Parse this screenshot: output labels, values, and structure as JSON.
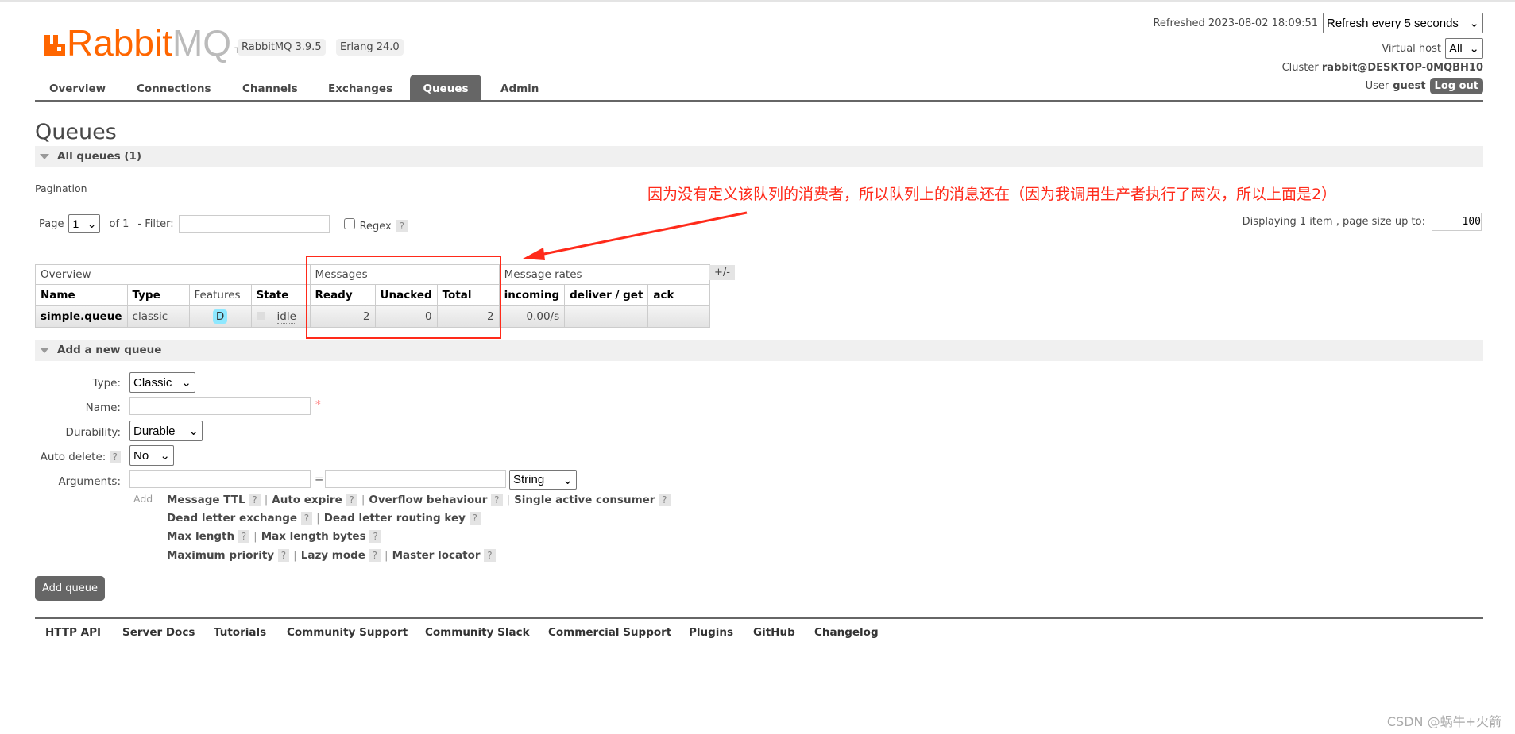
{
  "header": {
    "logo_text_orange": "Rabbit",
    "logo_text_grey": "MQ",
    "logo_tm": "TM",
    "version_rabbitmq": "RabbitMQ 3.9.5",
    "version_erlang": "Erlang 24.0",
    "refreshed": "Refreshed 2023-08-02 18:09:51",
    "refresh_select": "Refresh every 5 seconds",
    "vhost_label": "Virtual host",
    "vhost_select": "All",
    "cluster_label": "Cluster",
    "cluster_name": "rabbit@DESKTOP-0MQBH10",
    "user_label": "User",
    "user_name": "guest",
    "logout": "Log out",
    "brand_color": "#ff6600"
  },
  "tabs": [
    "Overview",
    "Connections",
    "Channels",
    "Exchanges",
    "Queues",
    "Admin"
  ],
  "active_tab": "Queues",
  "page_title": "Queues",
  "all_queues": "All queues (1)",
  "pagination": {
    "label": "Pagination",
    "page_label": "Page",
    "page_value": "1",
    "of": "of 1",
    "filter_label": "- Filter:",
    "filter_value": "",
    "regex_label": "Regex",
    "help": "?",
    "displaying": "Displaying 1 item , page size up to:",
    "page_size": "100"
  },
  "table": {
    "groups": [
      "Overview",
      "Messages",
      "Message rates"
    ],
    "toggle": "+/-",
    "columns": [
      "Name",
      "Type",
      "Features",
      "State",
      "Ready",
      "Unacked",
      "Total",
      "incoming",
      "deliver / get",
      "ack"
    ],
    "rows": [
      {
        "name": "simple.queue",
        "type": "classic",
        "features": "D",
        "state": "idle",
        "ready": "2",
        "unacked": "0",
        "total": "2",
        "incoming": "0.00/s",
        "deliver_get": "",
        "ack": ""
      }
    ]
  },
  "annotation": {
    "text": "因为没有定义该队列的消费者，所以队列上的消息还在（因为我调用生产者执行了两次，所以上面是2）",
    "color": "#ff2a1a"
  },
  "add_queue": {
    "section": "Add a new queue",
    "type_label": "Type:",
    "type_value": "Classic",
    "name_label": "Name:",
    "name_value": "",
    "required": "*",
    "durability_label": "Durability:",
    "durability_value": "Durable",
    "auto_delete_label": "Auto delete:",
    "auto_delete_value": "No",
    "arguments_label": "Arguments:",
    "eq": "=",
    "arg_type": "String",
    "add": "Add",
    "arg_links": [
      [
        "Message TTL",
        "Auto expire",
        "Overflow behaviour",
        "Single active consumer"
      ],
      [
        "Dead letter exchange",
        "Dead letter routing key"
      ],
      [
        "Max length",
        "Max length bytes"
      ],
      [
        "Maximum priority",
        "Lazy mode",
        "Master locator"
      ]
    ],
    "submit": "Add queue"
  },
  "footer": [
    "HTTP API",
    "Server Docs",
    "Tutorials",
    "Community Support",
    "Community Slack",
    "Commercial Support",
    "Plugins",
    "GitHub",
    "Changelog"
  ],
  "watermark": "CSDN @蜗牛+火箭"
}
